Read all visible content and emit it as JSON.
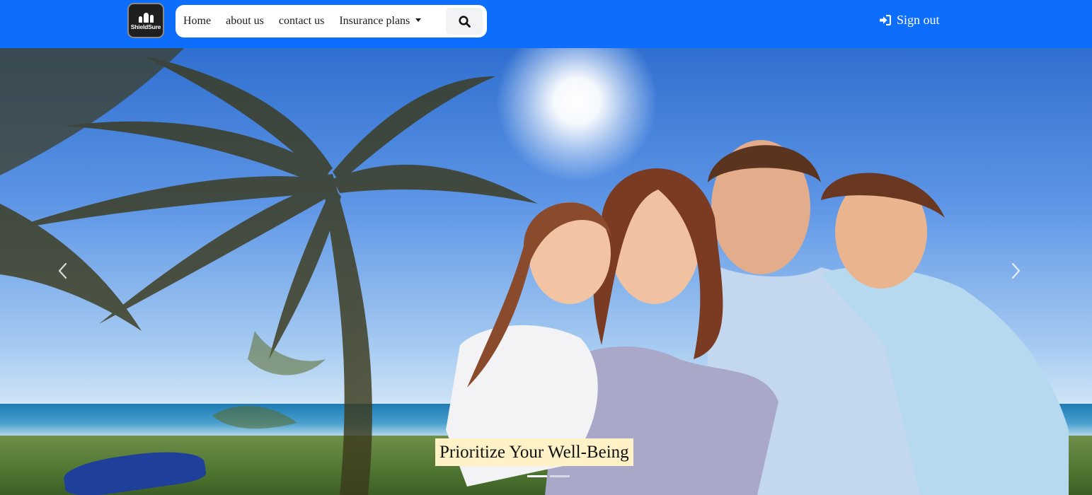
{
  "brand": {
    "logo_text": "ShieldSure",
    "logo_icon": "family-umbrella-icon"
  },
  "nav": {
    "items": [
      {
        "label": "Home"
      },
      {
        "label": "about us"
      },
      {
        "label": "contact us"
      },
      {
        "label": "Insurance plans",
        "dropdown": true
      }
    ],
    "search_icon": "search-icon"
  },
  "account": {
    "signout_label": "Sign out",
    "signout_icon": "sign-in-arrow-icon"
  },
  "carousel": {
    "caption": "Prioritize Your Well-Being",
    "slide_count": 2,
    "active_slide": 1,
    "prev_icon": "chevron-left-icon",
    "next_icon": "chevron-right-icon"
  },
  "colors": {
    "navbar": "#0d6efd",
    "caption_bg": "#fff2c6",
    "text_on_nav": "#ffffff"
  }
}
